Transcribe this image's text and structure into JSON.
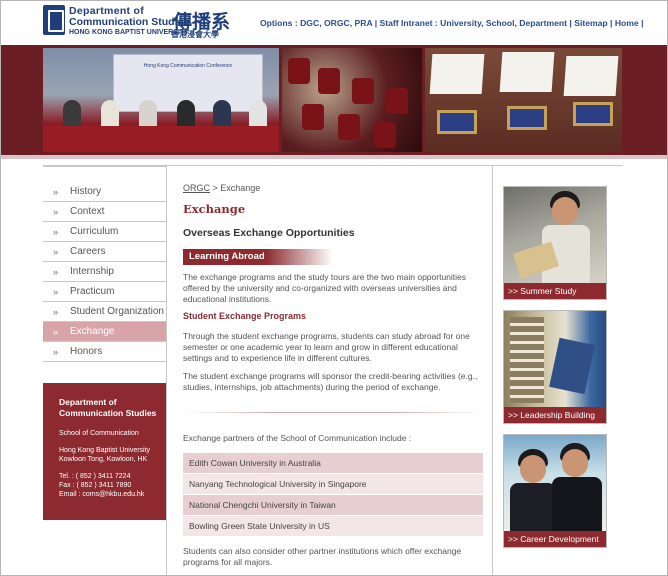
{
  "header": {
    "logo_en_line1": "Department of",
    "logo_en_line2": "Communication Studies",
    "logo_en_line3": "HONG KONG BAPTIST UNIVERSITY",
    "logo_zh_line1": "傳播系",
    "logo_zh_line2": "香港浸會大學",
    "topnav": "Options : DGC, ORGC, PRA | Staff Intranet : University, School, Department | Sitemap | Home |"
  },
  "banner": {
    "screen_text": "Hong Kong Communication Conference"
  },
  "sidebar": {
    "items": [
      {
        "label": "History",
        "active": false
      },
      {
        "label": "Context",
        "active": false
      },
      {
        "label": "Curriculum",
        "active": false
      },
      {
        "label": "Careers",
        "active": false
      },
      {
        "label": "Internship",
        "active": false
      },
      {
        "label": "Practicum",
        "active": false
      },
      {
        "label": "Student Organization",
        "active": false
      },
      {
        "label": "Exchange",
        "active": true
      },
      {
        "label": "Honors",
        "active": false
      }
    ],
    "contact": {
      "name_line1": "Department of",
      "name_line2": "Communication Studies",
      "school": "School of Communication",
      "addr1": "Hong Kong Baptist University",
      "addr2": "Kowloon Tong, Kowloon, HK",
      "tel": "Tel. : ( 852 ) 3411 7224",
      "fax": "Fax : ( 852 ) 3411 7890",
      "email": "Email : coms@hkbu.edu.hk"
    }
  },
  "main": {
    "breadcrumb_link": "ORGC",
    "breadcrumb_rest": " > Exchange",
    "page_title": "Exchange",
    "section_title": "Overseas Exchange Opportunities",
    "bar_label": "Learning Abroad",
    "para1": "The exchange programs and the study tours are the two main opportunities offered by the university and co-organized with overseas universities and educational institutions.",
    "sub_title": "Student Exchange Programs",
    "para2": "Through the student exchange programs, students can study abroad for one semester or one academic year to learn and grow in different educational settings and to experience life in different cultures.",
    "para3": "The student exchange programs will sponsor the credit-bearing activities (e.g., studies, internships, job attachments) during the period of exchange.",
    "partners_intro": "Exchange partners of the School of Communication include :",
    "partners": [
      "Edith Cowan University in Australia",
      "Nanyang Technological University in Singapore",
      "National Chengchi University in Taiwan",
      "Bowling Green State University in US"
    ],
    "closing": "Students can also consider other partner institutions which offer exchange programs for all majors."
  },
  "right": {
    "promos": [
      {
        "caption": ">> Summer Study"
      },
      {
        "caption": ">> Leadership Building"
      },
      {
        "caption": ">> Career Development"
      }
    ]
  },
  "colors": {
    "brand_navy": "#1f3f7a",
    "brand_maroon": "#8c2a2f",
    "active_menu": "#d8a4a8"
  }
}
